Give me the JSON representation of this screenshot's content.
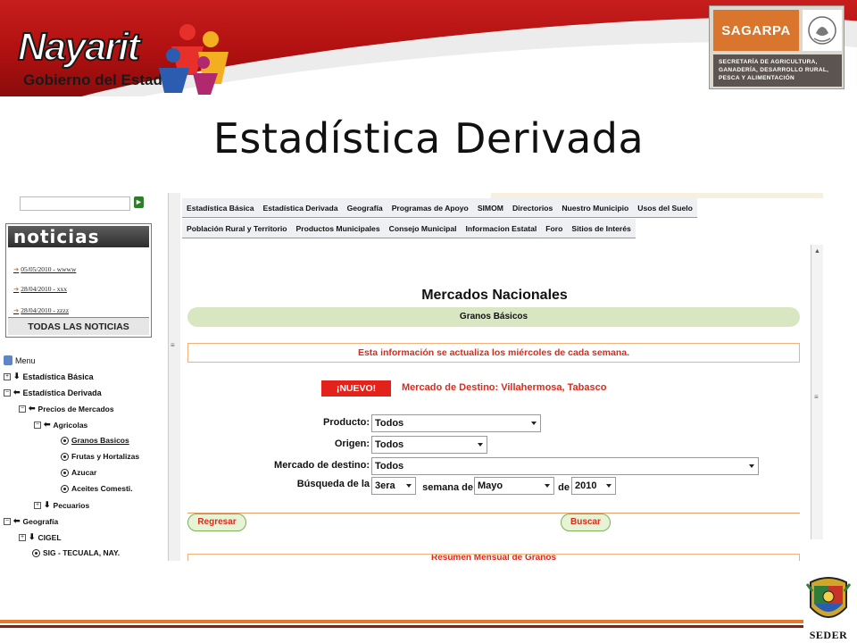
{
  "header": {
    "nayarit": {
      "name": "Nayarit",
      "subtitle": "Gobierno del Estado"
    },
    "sagarpa": {
      "name": "SAGARPA",
      "ministry": "SECRETARÍA DE AGRICULTURA, GANADERÍA, DESARROLLO RURAL, PESCA Y ALIMENTACIÓN"
    }
  },
  "slide": {
    "title": "Estadística Derivada"
  },
  "sidebar": {
    "noticias": {
      "heading": "noticias",
      "items": [
        "05/05/2010 - wwww",
        "28/04/2010 - xxx",
        "28/04/2010 - zzzz"
      ],
      "all_label": "TODAS LAS NOTICIAS"
    },
    "tree": {
      "menu": "Menu",
      "estadistica_basica": "Estadística Básica",
      "estadistica_derivada": "Estadística Derivada",
      "precios_mercados": "Precios de Mercados",
      "agricolas": "Agricolas",
      "granos_basicos": "Granos Basicos",
      "frutas_hortalizas": "Frutas y Hortalizas",
      "azucar": "Azucar",
      "aceites": "Aceites Comesti.",
      "pecuarios": "Pecuarios",
      "geografia": "Geografía",
      "cigel": "CIGEL",
      "sig": "SIG - TECUALA, NAY."
    }
  },
  "nav": {
    "row1": [
      "Estadística Básica",
      "Estadística Derivada",
      "Geografía",
      "Programas de Apoyo",
      "SIMOM",
      "Directorios",
      "Nuestro Municipio",
      "Usos del Suelo"
    ],
    "row2": [
      "Población Rural y Territorio",
      "Productos Municipales",
      "Consejo Municipal",
      "Informacion Estatal",
      "Foro",
      "Sitios de Interés"
    ]
  },
  "main": {
    "title": "Mercados Nacionales",
    "subtitle": "Granos Básicos",
    "info": "Esta información se actualiza los miércoles de cada semana.",
    "nuevo_badge": "¡NUEVO!",
    "destino_text": "Mercado de Destino: Villahermosa, Tabasco",
    "form": {
      "producto_label": "Producto:",
      "producto_value": "Todos",
      "origen_label": "Origen:",
      "origen_value": "Todos",
      "mercado_label": "Mercado de destino:",
      "mercado_value": "Todos",
      "busqueda_label": "Búsqueda de la",
      "semana_value": "3era",
      "semana_de_label": "semana de",
      "mes_value": "Mayo",
      "de_label": "de",
      "anio_value": "2010"
    },
    "regresar_label": "Regresar",
    "buscar_label": "Buscar",
    "bottom_box_text": "Resumen Mensual de Granos"
  },
  "footer": {
    "seder": "SEDER"
  },
  "colors": {
    "banner_red": "#c71d1d",
    "sagarpa_orange": "#d9752c",
    "alert_red": "#d92b1c",
    "green_bar": "#d8e7c2",
    "footer_orange": "#e5792b"
  }
}
